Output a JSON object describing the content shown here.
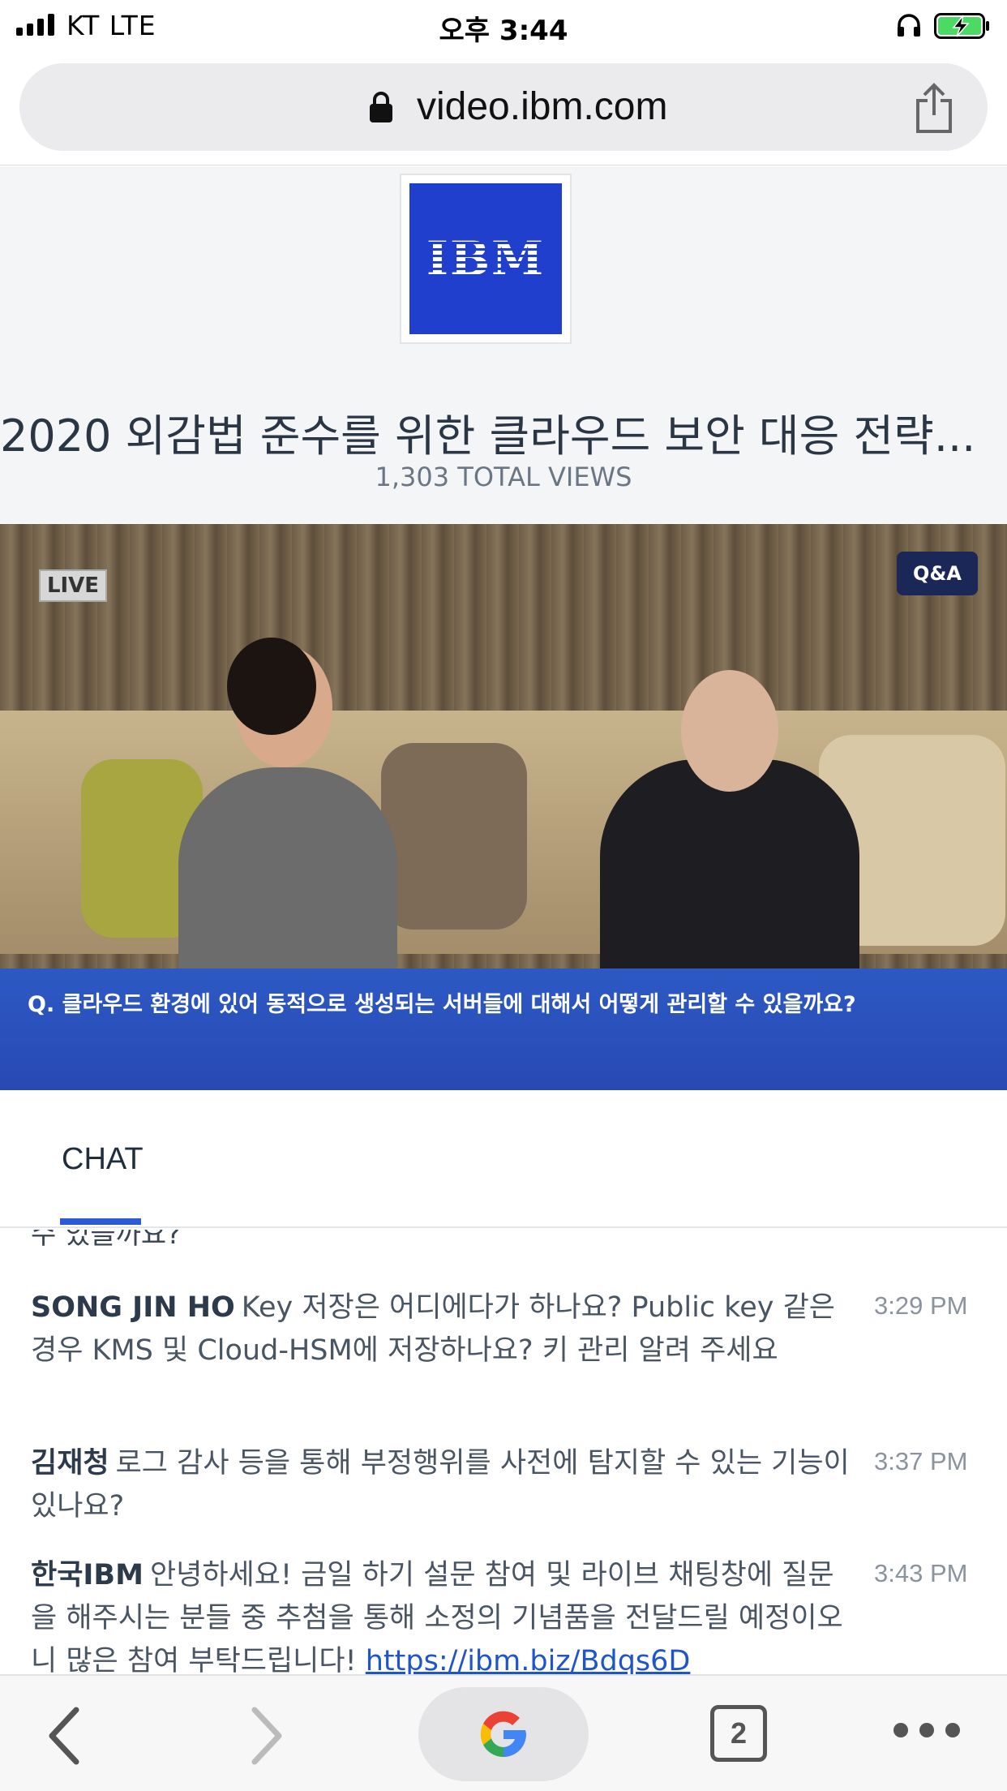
{
  "status_bar": {
    "carrier": "KT   LTE",
    "time": "오후 3:44"
  },
  "browser": {
    "url": "video.ibm.com"
  },
  "header": {
    "logo_text": "IBM",
    "title": "2020 외감법 준수를 위한 클라우드 보안 대응 전략...",
    "views": "1,303 TOTAL VIEWS"
  },
  "video": {
    "live_label": "LIVE",
    "qa_label": "Q&A",
    "caption": "Q. 클라우드 환경에 있어 동적으로 생성되는 서버들에 대해서 어떻게 관리할 수 있을까요?"
  },
  "tabs": {
    "chat_label": "CHAT"
  },
  "chat": {
    "cutoff_text": "수 있을까요?",
    "messages": [
      {
        "author": "SONG JIN HO",
        "text": "Key 저장은 어디에다가 하나요? Public key 같은 경우 KMS 및 Cloud-HSM에 저장하나요? 키 관리 알려 주세요",
        "time": "3:29 PM"
      },
      {
        "author": "김재청",
        "text": "로그 감사 등을 통해 부정행위를 사전에 탐지할 수 있는 기능이 있나요?",
        "time": "3:37 PM"
      },
      {
        "author": "한국IBM",
        "text": "안녕하세요! 금일 하기 설문 참여 및 라이브 채팅창에 질문을 해주시는 분들 중 추첨을 통해 소정의 기념품을 전달드릴 예정이오니 많은 참여 부탁드립니다!",
        "link": "https://ibm.biz/Bdqs6D",
        "time": "3:43 PM"
      }
    ]
  },
  "toolbar": {
    "tab_count": "2"
  },
  "colors": {
    "ibm_blue": "#1f3fcc",
    "caption_blue": "#2d59c4",
    "tab_accent": "#2d5bd6"
  }
}
